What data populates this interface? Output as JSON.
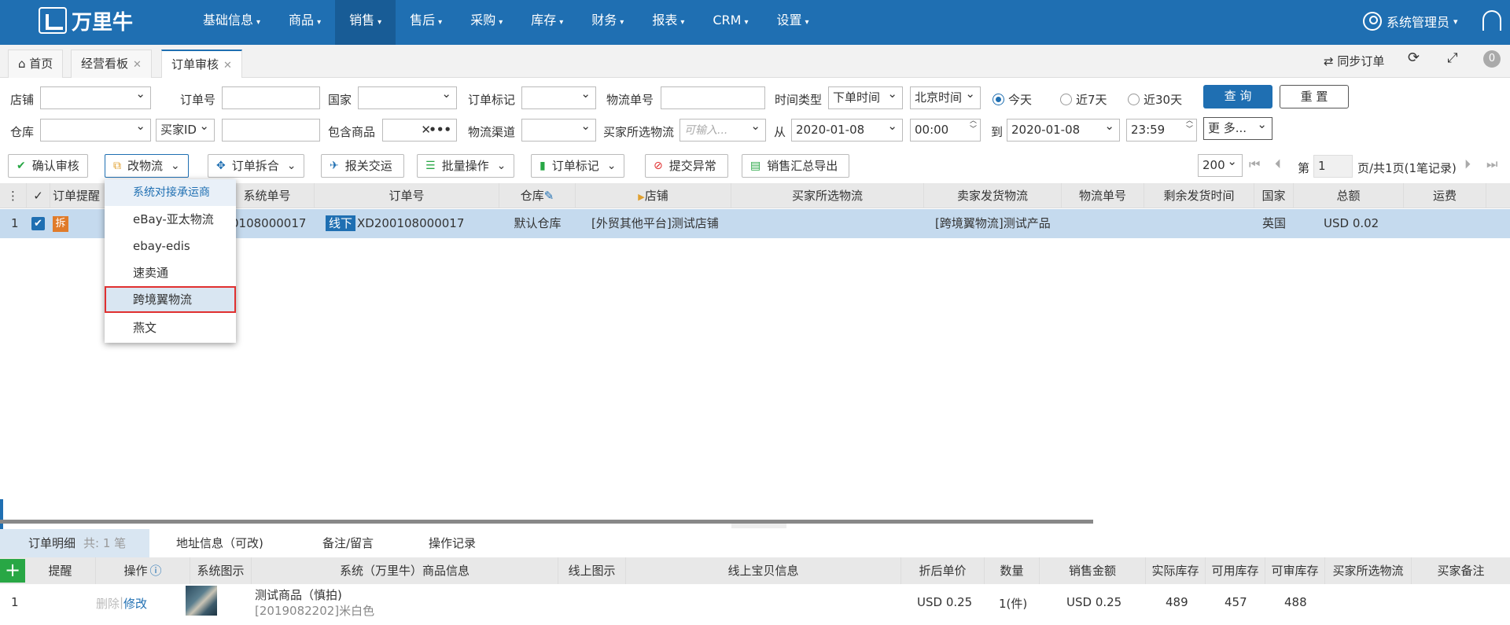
{
  "app": {
    "logo_text": "万里牛"
  },
  "nav": {
    "items": [
      {
        "label": "基础信息"
      },
      {
        "label": "商品"
      },
      {
        "label": "销售",
        "active": true
      },
      {
        "label": "售后"
      },
      {
        "label": "采购"
      },
      {
        "label": "库存"
      },
      {
        "label": "财务"
      },
      {
        "label": "报表"
      },
      {
        "label": "CRM"
      },
      {
        "label": "设置"
      }
    ],
    "user": "系统管理员"
  },
  "tabs": [
    {
      "label": "首页"
    },
    {
      "label": "经营看板"
    },
    {
      "label": "订单审核",
      "active": true
    }
  ],
  "tabbar_right": {
    "sync": "同步订单"
  },
  "filters": {
    "shop": "店铺",
    "order_no": "订单号",
    "country": "国家",
    "order_tag": "订单标记",
    "logistics_no": "物流单号",
    "time_type": "时间类型",
    "time_type_value": "下单时间",
    "tz_value": "北京时间",
    "today": "今天",
    "d7": "近7天",
    "d30": "近30天",
    "query": "查 询",
    "reset": "重 置",
    "warehouse": "仓库",
    "buyer_id": "买家ID",
    "contains": "包含商品",
    "channel": "物流渠道",
    "buyer_logistics": "买家所选物流",
    "buyer_logistics_ph": "可输入...",
    "from": "从",
    "date_from": "2020-01-08",
    "time_from": "00:00",
    "to": "到",
    "date_to": "2020-01-08",
    "time_to": "23:59",
    "more": "更 多..."
  },
  "toolbar": {
    "confirm": "确认审核",
    "change_logistics": "改物流",
    "split": "订单拆合",
    "customs": "报关交运",
    "batch": "批量操作",
    "tag": "订单标记",
    "abnormal": "提交异常",
    "export": "销售汇总导出",
    "page_size": "200",
    "page_label": "第",
    "page_no": "1",
    "page_info": "页/共1页(1笔记录)"
  },
  "grid": {
    "headers": [
      "订单提醒",
      "系统单号",
      "订单号",
      "仓库",
      "店铺",
      "买家所选物流",
      "卖家发货物流",
      "物流单号",
      "剩余发货时间",
      "国家",
      "总额",
      "运费"
    ],
    "row": {
      "index": "1",
      "badge": "拆",
      "sys_no": "0108000017",
      "offline": "线下",
      "order_no": "XD200108000017",
      "warehouse": "默认仓库",
      "shop": "[外贸其他平台]测试店铺",
      "seller_logistics": "[跨境翼物流]测试产品",
      "country": "英国",
      "total": "USD 0.02"
    }
  },
  "dropdown": {
    "items": [
      "系统对接承运商",
      "eBay-亚太物流",
      "ebay-edis",
      "速卖通",
      "跨境翼物流",
      "燕文"
    ]
  },
  "bottom": {
    "tabs": [
      "订单明细",
      "共: 1 笔",
      "地址信息（可改)",
      "备注/留言",
      "操作记录"
    ],
    "headers": [
      "提醒",
      "操作",
      "系统图示",
      "系统（万里牛）商品信息",
      "线上图示",
      "线上宝贝信息",
      "折后单价",
      "数量",
      "销售金额",
      "实际库存",
      "可用库存",
      "可审库存",
      "买家所选物流",
      "买家备注"
    ],
    "row": {
      "index": "1",
      "del": "删除",
      "sep": "|",
      "edit": "修改",
      "name": "测试商品（慎拍)",
      "sku": "[2019082202]米白色",
      "price": "USD 0.25",
      "qty": "1(件)",
      "amount": "USD 0.25",
      "stock": "489",
      "avail": "457",
      "audit": "488"
    }
  }
}
